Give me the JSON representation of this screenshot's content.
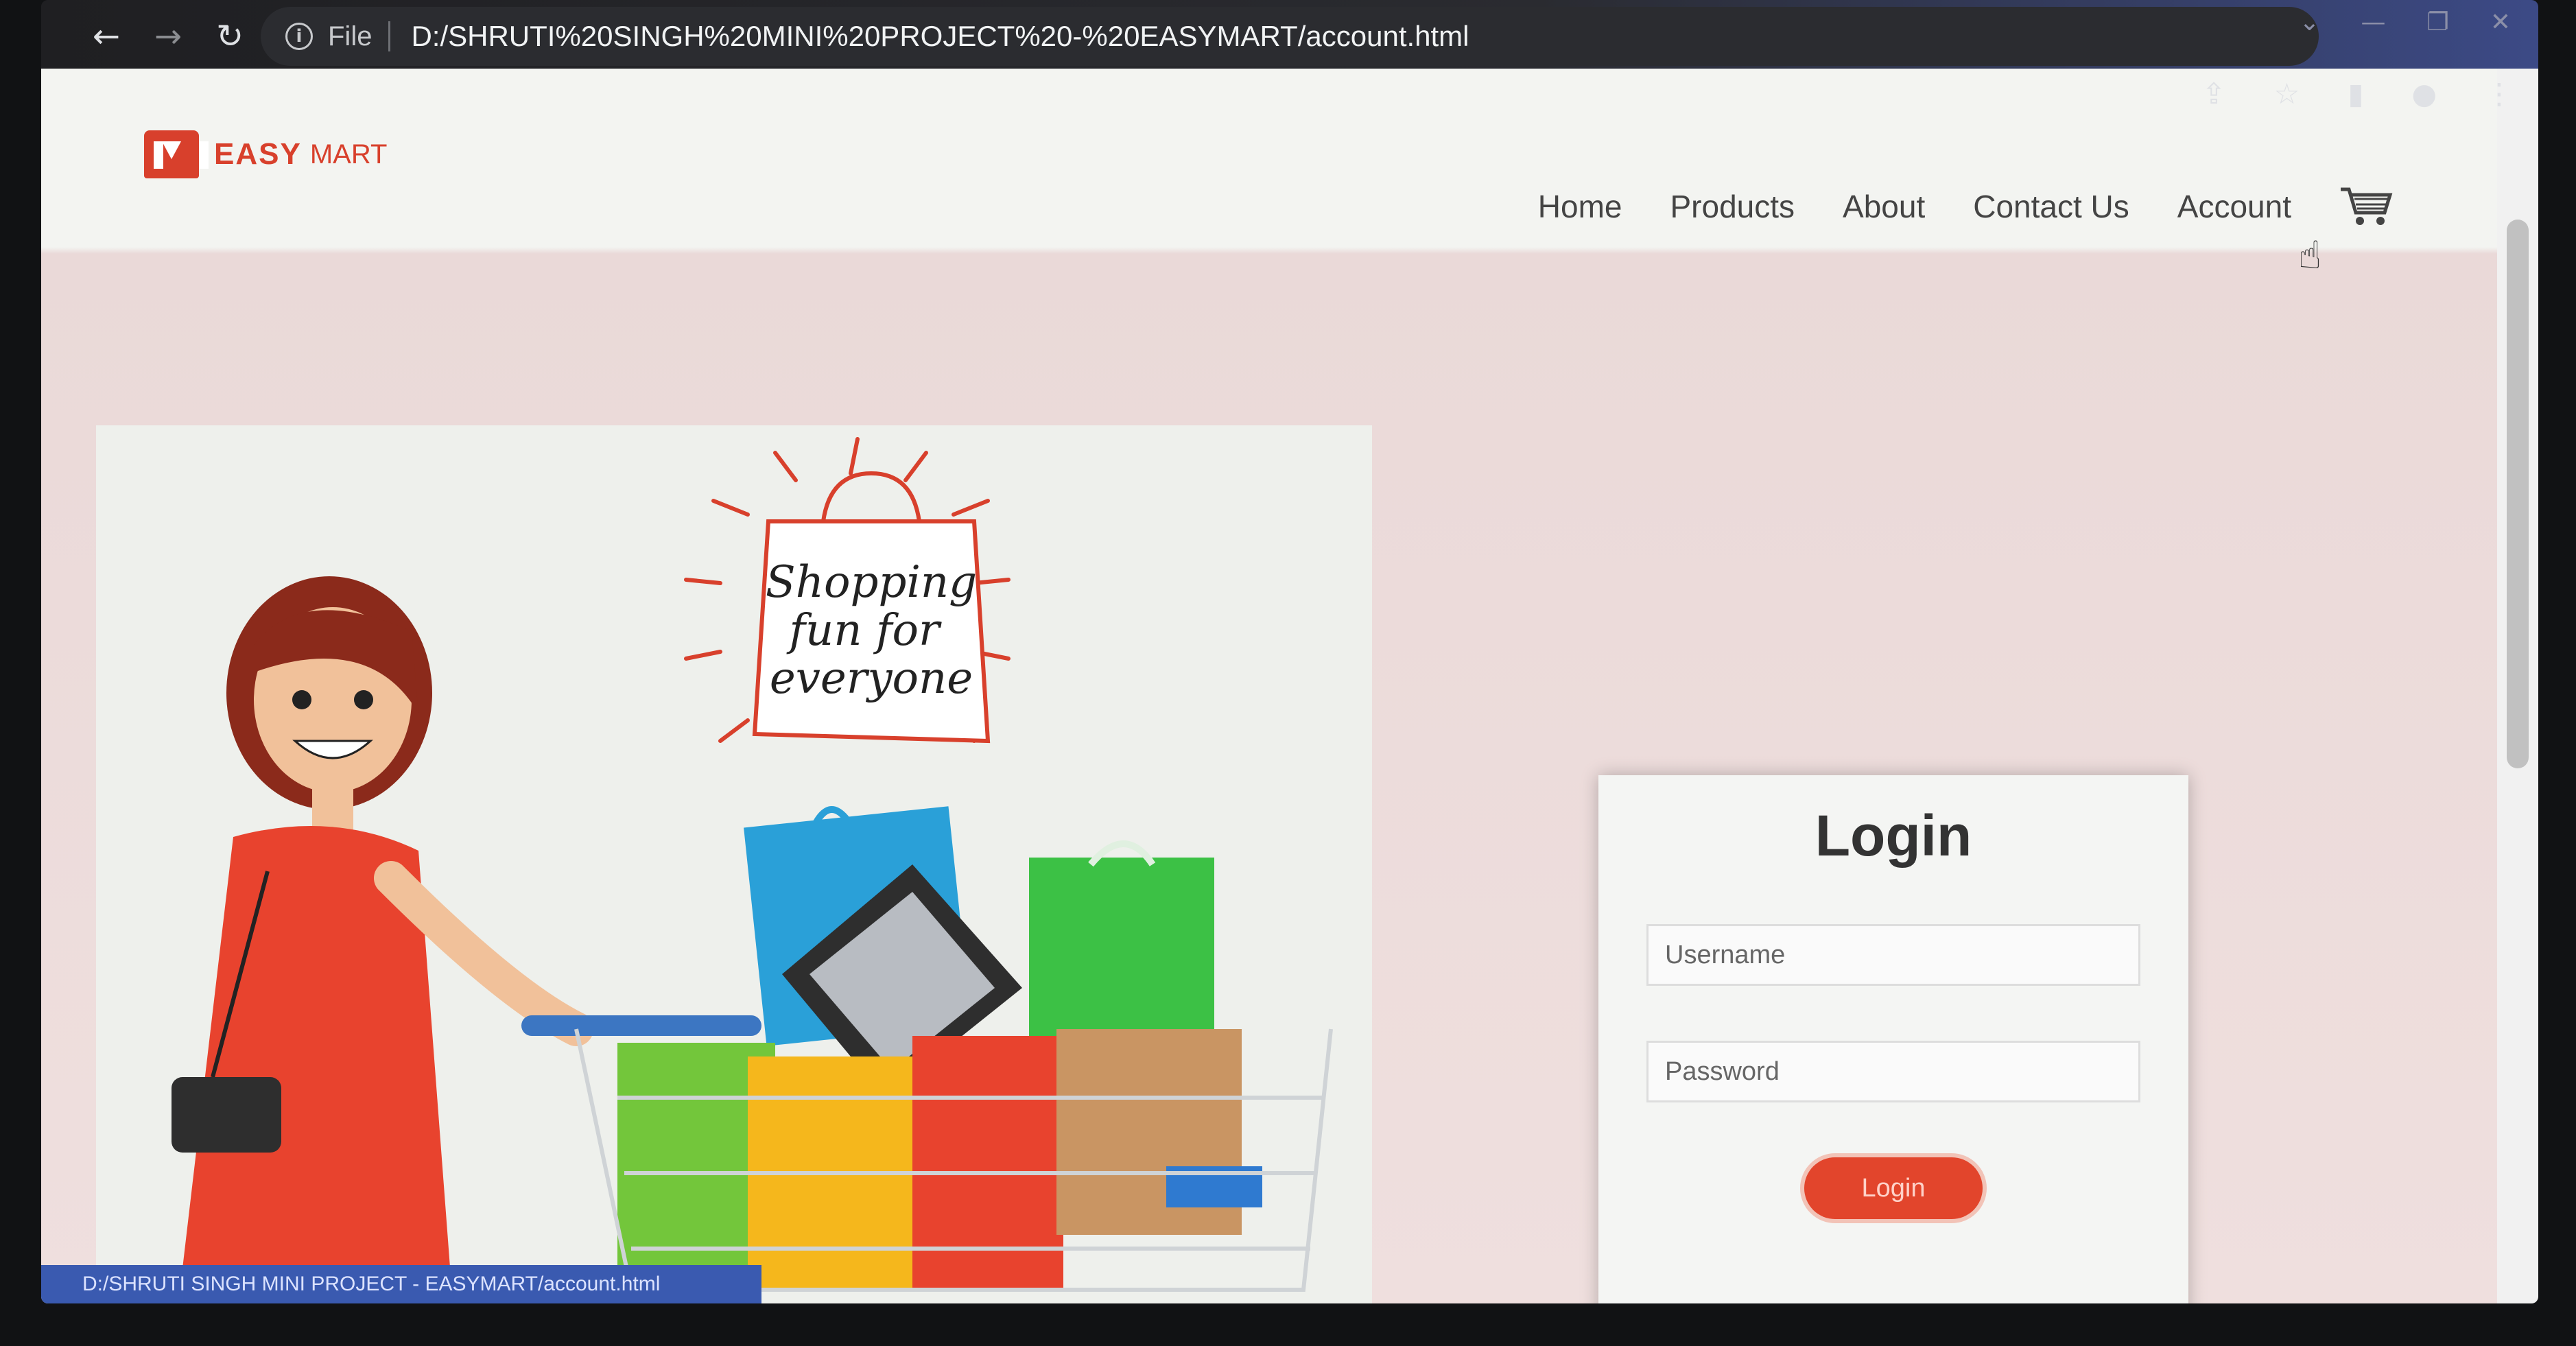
{
  "browser": {
    "file_label": "File",
    "url": "D:/SHRUTI%20SINGH%20MINI%20PROJECT%20-%20EASYMART/account.html",
    "status_url": "D:/SHRUTI SINGH MINI PROJECT - EASYMART/account.html"
  },
  "site": {
    "logo_strong": "EASY",
    "logo_light": "MART",
    "nav": [
      "Home",
      "Products",
      "About",
      "Contact Us",
      "Account"
    ]
  },
  "hero": {
    "badge_text": [
      "Shopping",
      "fun for",
      "everyone"
    ]
  },
  "login": {
    "title": "Login",
    "username_placeholder": "Username",
    "password_placeholder": "Password",
    "button_label": "Login"
  },
  "colors": {
    "brand": "#d8402c",
    "button": "#e2452c"
  }
}
